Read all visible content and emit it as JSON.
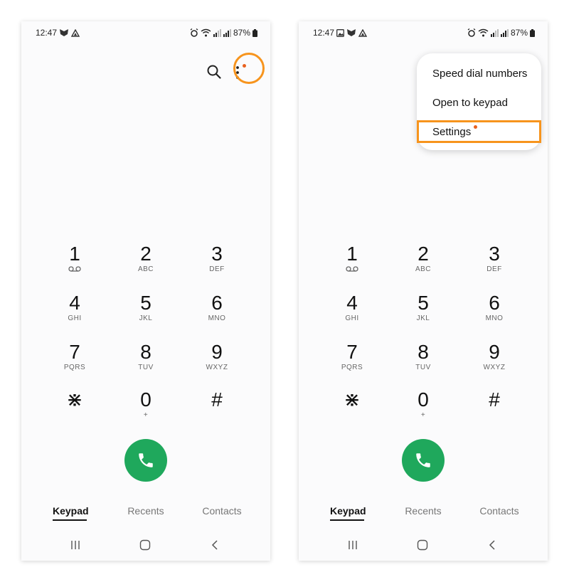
{
  "status_bar": {
    "time": "12:47",
    "battery_percent": "87%"
  },
  "keypad": {
    "keys": [
      {
        "digit": "1",
        "letters": ""
      },
      {
        "digit": "2",
        "letters": "ABC"
      },
      {
        "digit": "3",
        "letters": "DEF"
      },
      {
        "digit": "4",
        "letters": "GHI"
      },
      {
        "digit": "5",
        "letters": "JKL"
      },
      {
        "digit": "6",
        "letters": "MNO"
      },
      {
        "digit": "7",
        "letters": "PQRS"
      },
      {
        "digit": "8",
        "letters": "TUV"
      },
      {
        "digit": "9",
        "letters": "WXYZ"
      },
      {
        "digit": "⋇",
        "letters": ""
      },
      {
        "digit": "0",
        "letters": "+"
      },
      {
        "digit": "#",
        "letters": ""
      }
    ]
  },
  "tabs": [
    {
      "label": "Keypad",
      "active": true
    },
    {
      "label": "Recents",
      "active": false
    },
    {
      "label": "Contacts",
      "active": false
    }
  ],
  "menu": {
    "items": [
      {
        "label": "Speed dial numbers"
      },
      {
        "label": "Open to keypad"
      },
      {
        "label": "Settings"
      }
    ]
  },
  "colors": {
    "call_button": "#1fa85c",
    "highlight": "#f7941d",
    "notification_dot": "#e8611f"
  },
  "icons": {
    "voicemail": "voicemail-icon",
    "search": "search-icon",
    "more": "more-vertical-icon",
    "call": "phone-icon",
    "recent_apps": "recent-apps-icon",
    "home": "home-icon",
    "back": "back-icon"
  }
}
